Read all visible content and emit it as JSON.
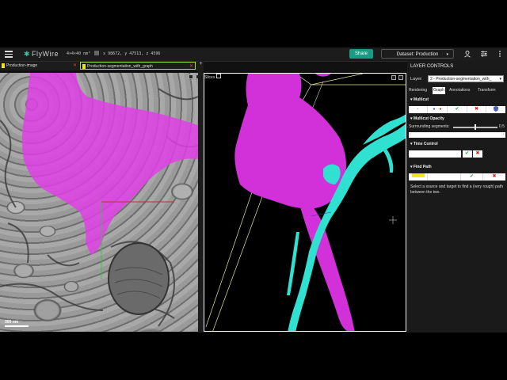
{
  "topbar": {
    "logo_mark": "✱",
    "logo_text": "FlyWire",
    "resolution": "4×4×40 nm³",
    "coords": "x 98672, y 47513, z 4596",
    "share_label": "Share",
    "dataset_label": "Dataset: Production",
    "dataset_caret": "▾",
    "icons": [
      "user-icon",
      "sliders-icon",
      "more-vertical-icon"
    ]
  },
  "layer_tabs": [
    {
      "label": "Production-image",
      "color": "#f2e41c"
    },
    {
      "label": "Production-segmentation_with_graph",
      "color": "#f2e41c"
    }
  ],
  "em_panel": {
    "scalebar_label": "300 nm"
  },
  "view3d": {
    "slices_label": "Slices"
  },
  "sidebar": {
    "title": "LAYER CONTROLS",
    "layer_label": "Layer:",
    "layer_value": "2 - Production-segmentation_with_",
    "tabs": [
      "Rendering",
      "Graph",
      "Annotations",
      "Transform"
    ],
    "active_tab": "Graph",
    "multicut": {
      "title": "Multicut",
      "buttons": [
        "-",
        "●·●",
        "✔",
        "✖",
        "shield"
      ]
    },
    "multicut_opacity": {
      "title": "Multicut Opacity",
      "surrounding_label": "Surrounding segments:",
      "surrounding_value": "0.5",
      "surrounding_fraction": 0.5
    },
    "time_control": {
      "title": "Time Control",
      "check": "✔",
      "cross": "✖"
    },
    "find_path": {
      "title": "Find Path",
      "check": "✔",
      "cross": "✖",
      "description": "Select a source and target to find a (very rough) path between the two."
    }
  },
  "colors": {
    "segment_magenta": "#e040e8",
    "segment_cyan": "#40e8d8",
    "accent_green": "#1a9c84",
    "tag_yellow": "#f2e41c"
  }
}
